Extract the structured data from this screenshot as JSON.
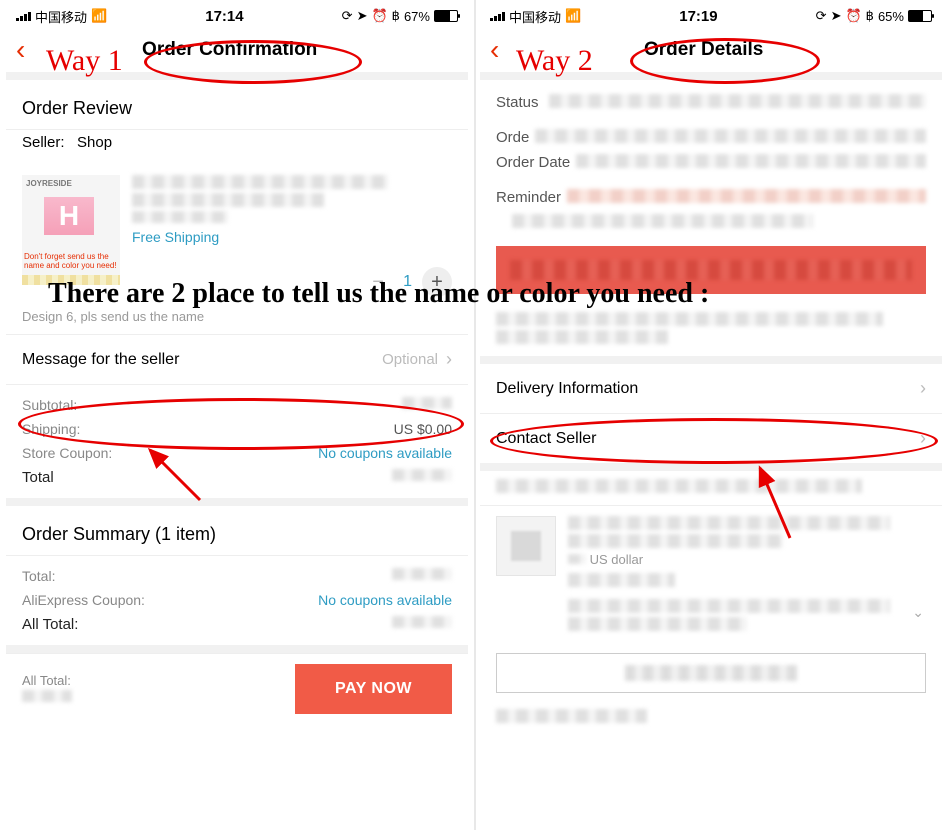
{
  "annotations": {
    "way1_label": "Way 1",
    "way2_label": "Way 2",
    "overlay": "There are 2 place to tell us the name or color you need :"
  },
  "left": {
    "status": {
      "carrier": "中国移动",
      "time": "17:14",
      "battery_pct": "67%"
    },
    "nav_title": "Order Confirmation",
    "order_review_heading": "Order Review",
    "seller_label": "Seller:",
    "seller_name": "Shop",
    "thumb_brand": "JOYRESIDE",
    "thumb_msg": "Don't forget send us the name and color you need!",
    "free_shipping": "Free Shipping",
    "qty_value": "1",
    "variant_note": "Design 6, pls send us the name",
    "message_row_label": "Message for the seller",
    "message_row_placeholder": "Optional",
    "totals": {
      "subtotal_label": "Subtotal:",
      "shipping_label": "Shipping:",
      "shipping_value": "US $0.00",
      "coupon_label": "Store Coupon:",
      "coupon_value": "No coupons available",
      "total_label": "Total"
    },
    "summary_heading": "Order Summary (1 item)",
    "summary": {
      "total_label": "Total:",
      "ae_coupon_label": "AliExpress Coupon:",
      "ae_coupon_value": "No coupons available",
      "all_total_label": "All Total:"
    },
    "paybar": {
      "all_total_label": "All Total:",
      "button": "PAY NOW"
    }
  },
  "right": {
    "status": {
      "carrier": "中国移动",
      "time": "17:19",
      "battery_pct": "65%"
    },
    "nav_title": "Order Details",
    "fields": {
      "status_label": "Status",
      "order_label": "Orde",
      "order_date_label": "Order Date",
      "reminder_label": "Reminder"
    },
    "delivery_row": "Delivery Information",
    "contact_row": "Contact Seller",
    "currency_hint": "US dollar"
  }
}
